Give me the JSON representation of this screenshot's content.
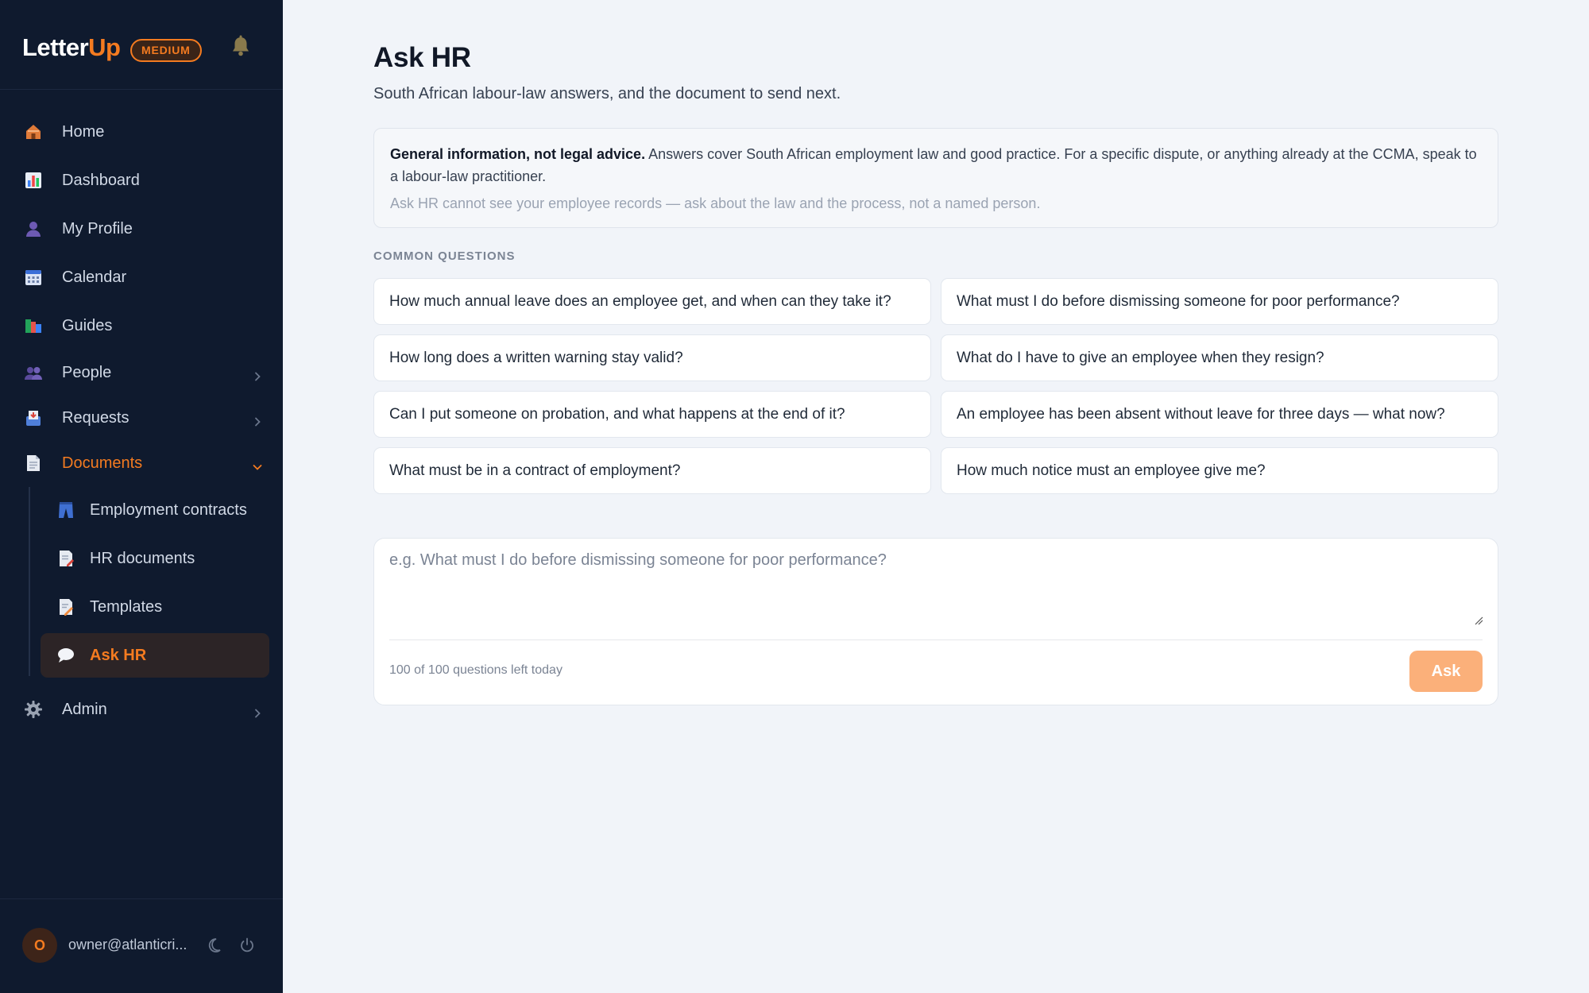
{
  "brand": {
    "name_part1": "Letter",
    "name_part2": "Up",
    "plan": "MEDIUM"
  },
  "nav": {
    "home": "Home",
    "dashboard": "Dashboard",
    "my_profile": "My Profile",
    "calendar": "Calendar",
    "guides": "Guides",
    "people": "People",
    "requests": "Requests",
    "documents": "Documents",
    "admin": "Admin",
    "documents_children": {
      "employment_contracts": "Employment contracts",
      "hr_documents": "HR documents",
      "templates": "Templates",
      "ask_hr": "Ask HR"
    }
  },
  "user": {
    "initial": "O",
    "email": "owner@atlanticri..."
  },
  "page": {
    "title": "Ask HR",
    "subtitle": "South African labour-law answers, and the document to send next."
  },
  "notice": {
    "bold": "General information, not legal advice.",
    "text": " Answers cover South African employment law and good practice. For a specific dispute, or anything already at the CCMA, speak to a labour-law practitioner.",
    "muted": "Ask HR cannot see your employee records — ask about the law and the process, not a named person."
  },
  "common_questions": {
    "label": "COMMON QUESTIONS",
    "items": [
      "How much annual leave does an employee get, and when can they take it?",
      "What must I do before dismissing someone for poor performance?",
      "How long does a written warning stay valid?",
      "What do I have to give an employee when they resign?",
      "Can I put someone on probation, and what happens at the end of it?",
      "An employee has been absent without leave for three days — what now?",
      "What must be in a contract of employment?",
      "How much notice must an employee give me?"
    ]
  },
  "ask": {
    "placeholder": "e.g. What must I do before dismissing someone for poor performance?",
    "quota": "100 of 100 questions left today",
    "button": "Ask"
  },
  "colors": {
    "accent": "#f47b20",
    "sidebar_bg": "#0f1a2e",
    "page_bg": "#f1f4f9"
  }
}
